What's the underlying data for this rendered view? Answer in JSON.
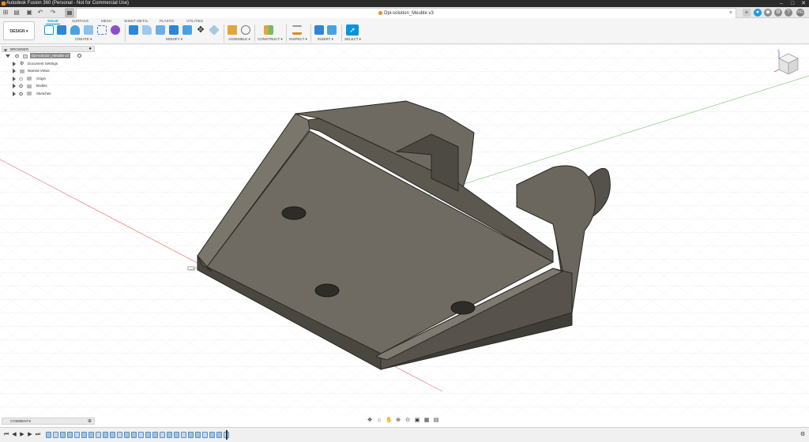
{
  "window": {
    "title": "Autodesk Fusion 360 (Personal - Not for Commercial Use)",
    "minimize": "–",
    "maximize": "□",
    "close": "✕"
  },
  "tabbar": {
    "document_tab": "Dpi-solution_Meuble v3",
    "tab_close": "×",
    "new_tab": "+",
    "user_initials": "PG"
  },
  "ribbon": {
    "workspace": "DESIGN ▾",
    "tabs": [
      "SOLID",
      "SURFACE",
      "MESH",
      "SHEET METAL",
      "PLASTIC",
      "UTILITIES"
    ],
    "active_tab": "SOLID",
    "groups": [
      "CREATE ▾",
      "MODIFY ▾",
      "ASSEMBLE ▾",
      "CONSTRUCT ▾",
      "INSPECT ▾",
      "INSERT ▾",
      "SELECT ▾"
    ]
  },
  "browser": {
    "header": "BROWSER",
    "root": "Dpi-solution_Meuble v3",
    "items": [
      "Document Settings",
      "Named Views",
      "Origin",
      "Bodies",
      "Sketches"
    ]
  },
  "comments": {
    "header": "COMMENTS"
  },
  "viewcube": {
    "label": "FRONT"
  },
  "colors": {
    "accent": "#0696d7",
    "titlebar": "#2b2b2b",
    "model_face": "#6e6a61",
    "model_edge": "#2a2824"
  },
  "timeline": {
    "features": 26
  }
}
